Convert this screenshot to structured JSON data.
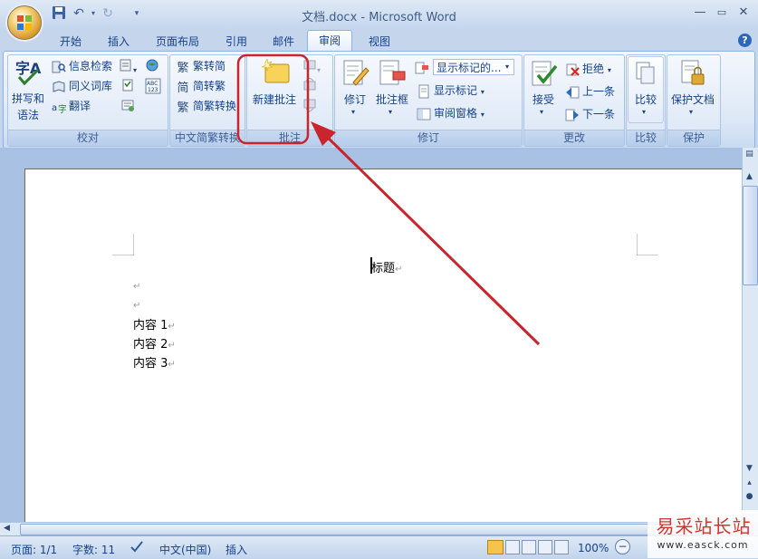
{
  "window": {
    "title": "文档.docx - Microsoft Word"
  },
  "quick_access": {
    "icons": [
      "save-icon",
      "undo-icon",
      "redo-icon",
      "customize-icon"
    ]
  },
  "tabs": [
    {
      "label": "开始"
    },
    {
      "label": "插入"
    },
    {
      "label": "页面布局"
    },
    {
      "label": "引用"
    },
    {
      "label": "邮件"
    },
    {
      "label": "审阅",
      "active": true
    },
    {
      "label": "视图"
    }
  ],
  "ribbon": {
    "proofing": {
      "label": "校对",
      "spelling": "拼写和\n语法",
      "spelling_l1": "拼写和",
      "spelling_l2": "语法",
      "research": "信息检索",
      "thesaurus": "同义词库",
      "translate": "翻译"
    },
    "chinese": {
      "label": "中文简繁转换",
      "to_traditional": "繁转简",
      "to_simplified": "简转繁",
      "convert": "简繁转换",
      "glyph_trad": "繁",
      "glyph_simp": "简",
      "glyph_conv": "繁"
    },
    "comments": {
      "label": "批注",
      "new_comment": "新建批注"
    },
    "tracking": {
      "label": "修订",
      "track_changes": "修订",
      "balloons": "批注框",
      "display_markup": "显示标记的...",
      "show_markup": "显示标记",
      "reviewing_pane": "审阅窗格"
    },
    "changes": {
      "label": "更改",
      "accept": "接受",
      "reject": "拒绝",
      "previous": "上一条",
      "next": "下一条"
    },
    "compare": {
      "label": "比较",
      "compare": "比较"
    },
    "protect": {
      "label": "保护",
      "protect_doc": "保护文档"
    }
  },
  "document": {
    "title_line": "标题",
    "paragraphs": [
      "",
      "",
      "内容 1",
      "内容 2",
      "内容 3"
    ],
    "para_mark": "↵"
  },
  "status": {
    "page": "页面: 1/1",
    "words": "字数: 11",
    "language": "中文(中国)",
    "mode": "插入",
    "zoom": "100%"
  },
  "watermark": {
    "text": "易采站长站",
    "url": "www.easck.com"
  },
  "colors": {
    "annotation": "#c8252c",
    "accent": "#15428b"
  }
}
